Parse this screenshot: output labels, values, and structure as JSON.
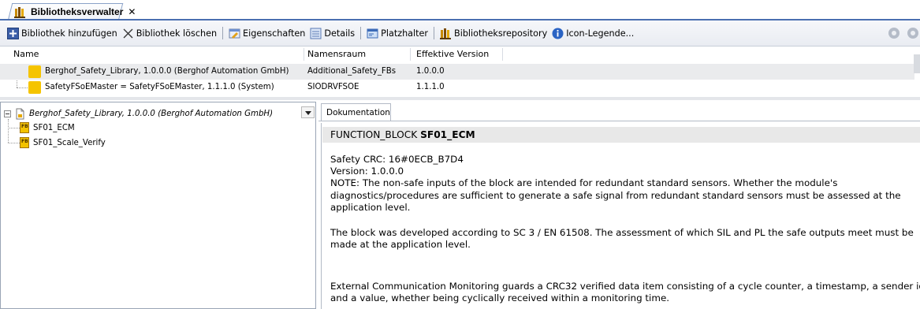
{
  "tab": {
    "title": "Bibliotheksverwalter",
    "close_glyph": "✕"
  },
  "toolbar": {
    "add_library": "Bibliothek hinzufügen",
    "delete_library": "Bibliothek löschen",
    "properties": "Eigenschaften",
    "details": "Details",
    "placeholder": "Platzhalter",
    "repository": "Bibliotheksrepository",
    "icon_legend": "Icon-Legende..."
  },
  "library_table": {
    "columns": [
      "Name",
      "Namensraum",
      "Effektive Version"
    ],
    "rows": [
      {
        "name": "Berghof_Safety_Library, 1.0.0.0 (Berghof Automation GmbH)",
        "namespace": "Additional_Safety_FBs",
        "version": "1.0.0.0"
      },
      {
        "name": "SafetyFSoEMaster = SafetyFSoEMaster, 1.1.1.0 (System)",
        "namespace": "SIODRVFSOE",
        "version": "1.1.1.0"
      }
    ]
  },
  "tree": {
    "root": "Berghof_Safety_Library, 1.0.0.0 (Berghof Automation GmbH)",
    "items": [
      "SF01_ECM",
      "SF01_Scale_Verify"
    ]
  },
  "doc": {
    "tab_label": "Dokumentation",
    "header_prefix": "FUNCTION_BLOCK ",
    "header_name": "SF01_ECM",
    "crc": "Safety CRC: 16#0ECB_B7D4",
    "version": "Version: 1.0.0.0",
    "note_lines": [
      "NOTE: The non-safe inputs of the block are intended for redundant standard sensors. Whether the module's",
      "diagnostics/procedures are sufficient to generate a safe signal from redundant standard sensors must be assessed at the",
      "application level."
    ],
    "dev_lines": [
      "The block was developed according to SC 3 / EN 61508. The assessment of which SIL and PL the safe outputs meet must be",
      "made at the application level."
    ],
    "ecm_lines": [
      "External Communication Monitoring guards a CRC32 verified data item consisting of a cycle counter, a timestamp, a sender id,",
      "and a value, whether being cyclically received within a monitoring time."
    ]
  },
  "colors": {
    "accent": "#4a6fb1",
    "selected_row": "#eaebed",
    "library_icon": "#f5c400",
    "header_bar": "#e8e8e8"
  }
}
